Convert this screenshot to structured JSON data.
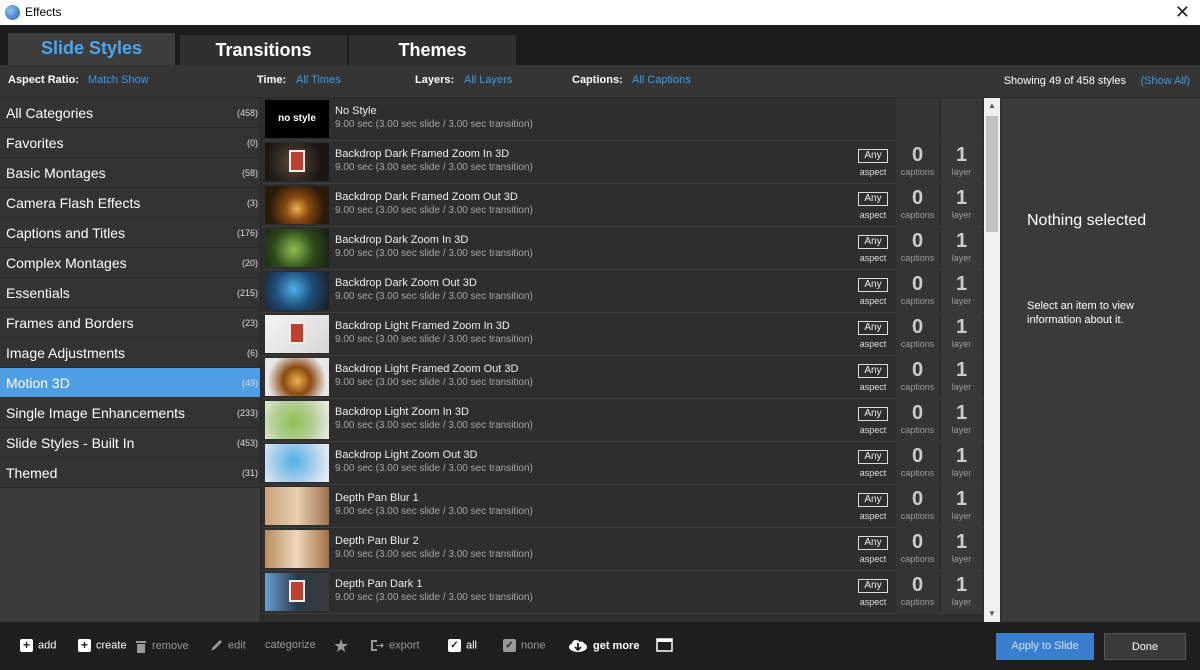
{
  "window": {
    "title": "Effects",
    "close_glyph": "✕"
  },
  "tabs": [
    {
      "label": "Slide Styles",
      "active": true
    },
    {
      "label": "Transitions",
      "active": false
    },
    {
      "label": "Themes",
      "active": false
    }
  ],
  "filters": {
    "aspect_label": "Aspect Ratio:",
    "aspect_value": "Match Show",
    "time_label": "Time:",
    "time_value": "All Times",
    "layers_label": "Layers:",
    "layers_value": "All Layers",
    "captions_label": "Captions:",
    "captions_value": "All Captions",
    "showing": "Showing 49 of 458 styles",
    "show_all": "(Show All)"
  },
  "categories": [
    {
      "name": "All Categories",
      "count": "(458)"
    },
    {
      "name": "Favorites",
      "count": "(0)"
    },
    {
      "name": "Basic Montages",
      "count": "(58)"
    },
    {
      "name": "Camera Flash Effects",
      "count": "(3)"
    },
    {
      "name": "Captions and Titles",
      "count": "(176)"
    },
    {
      "name": "Complex Montages",
      "count": "(20)"
    },
    {
      "name": "Essentials",
      "count": "(215)"
    },
    {
      "name": "Frames and Borders",
      "count": "(23)"
    },
    {
      "name": "Image Adjustments",
      "count": "(6)"
    },
    {
      "name": "Motion 3D",
      "count": "(49)",
      "selected": true
    },
    {
      "name": "Single Image Enhancements",
      "count": "(233)"
    },
    {
      "name": "Slide Styles - Built In",
      "count": "(453)"
    },
    {
      "name": "Themed",
      "count": "(31)"
    }
  ],
  "styles": [
    {
      "name": "No Style",
      "duration": "9.00 sec (3.00 sec slide / 3.00 sec transition)",
      "thumb": "nostyle",
      "thumb_text": "no style",
      "stats": false
    },
    {
      "name": "Backdrop Dark Framed Zoom In 3D",
      "duration": "9.00 sec (3.00 sec slide / 3.00 sec transition)",
      "thumb": "dark",
      "aspect": "Any",
      "aspect_label": "aspect",
      "captions": "0",
      "captions_label": "captions",
      "layers": "1",
      "layers_label": "layer",
      "stats": true
    },
    {
      "name": "Backdrop Dark Framed Zoom Out 3D",
      "duration": "9.00 sec (3.00 sec slide / 3.00 sec transition)",
      "thumb": "forest",
      "aspect": "Any",
      "aspect_label": "aspect",
      "captions": "0",
      "captions_label": "captions",
      "layers": "1",
      "layers_label": "layer",
      "stats": true
    },
    {
      "name": "Backdrop Dark Zoom In 3D",
      "duration": "9.00 sec (3.00 sec slide / 3.00 sec transition)",
      "thumb": "green",
      "aspect": "Any",
      "aspect_label": "aspect",
      "captions": "0",
      "captions_label": "captions",
      "layers": "1",
      "layers_label": "layer",
      "stats": true
    },
    {
      "name": "Backdrop Dark Zoom Out 3D",
      "duration": "9.00 sec (3.00 sec slide / 3.00 sec transition)",
      "thumb": "blue",
      "aspect": "Any",
      "aspect_label": "aspect",
      "captions": "0",
      "captions_label": "captions",
      "layers": "1",
      "layers_label": "layer",
      "stats": true
    },
    {
      "name": "Backdrop Light Framed Zoom In 3D",
      "duration": "9.00 sec (3.00 sec slide / 3.00 sec transition)",
      "thumb": "light",
      "aspect": "Any",
      "aspect_label": "aspect",
      "captions": "0",
      "captions_label": "captions",
      "layers": "1",
      "layers_label": "layer",
      "stats": true
    },
    {
      "name": "Backdrop Light Framed Zoom Out 3D",
      "duration": "9.00 sec (3.00 sec slide / 3.00 sec transition)",
      "thumb": "forestl",
      "aspect": "Any",
      "aspect_label": "aspect",
      "captions": "0",
      "captions_label": "captions",
      "layers": "1",
      "layers_label": "layer",
      "stats": true
    },
    {
      "name": "Backdrop Light Zoom In 3D",
      "duration": "9.00 sec (3.00 sec slide / 3.00 sec transition)",
      "thumb": "greenl",
      "aspect": "Any",
      "aspect_label": "aspect",
      "captions": "0",
      "captions_label": "captions",
      "layers": "1",
      "layers_label": "layer",
      "stats": true
    },
    {
      "name": "Backdrop Light Zoom Out 3D",
      "duration": "9.00 sec (3.00 sec slide / 3.00 sec transition)",
      "thumb": "bluel",
      "aspect": "Any",
      "aspect_label": "aspect",
      "captions": "0",
      "captions_label": "captions",
      "layers": "1",
      "layers_label": "layer",
      "stats": true
    },
    {
      "name": "Depth Pan Blur 1",
      "duration": "9.00 sec (3.00 sec slide / 3.00 sec transition)",
      "thumb": "blur1",
      "aspect": "Any",
      "aspect_label": "aspect",
      "captions": "0",
      "captions_label": "captions",
      "layers": "1",
      "layers_label": "layer",
      "stats": true
    },
    {
      "name": "Depth Pan Blur 2",
      "duration": "9.00 sec (3.00 sec slide / 3.00 sec transition)",
      "thumb": "blur2",
      "aspect": "Any",
      "aspect_label": "aspect",
      "captions": "0",
      "captions_label": "captions",
      "layers": "1",
      "layers_label": "layer",
      "stats": true
    },
    {
      "name": "Depth Pan Dark 1",
      "duration": "9.00 sec (3.00 sec slide / 3.00 sec transition)",
      "thumb": "dark1",
      "aspect": "Any",
      "aspect_label": "aspect",
      "captions": "0",
      "captions_label": "captions",
      "layers": "1",
      "layers_label": "layer",
      "stats": true
    }
  ],
  "scrollbar": {
    "up_glyph": "▲",
    "down_glyph": "▼"
  },
  "info": {
    "title": "Nothing selected",
    "description": "Select an item to view information about it."
  },
  "toolbar": {
    "add": "add",
    "create": "create",
    "remove": "remove",
    "edit": "edit",
    "categorize": "categorize",
    "export": "export",
    "all": "all",
    "none": "none",
    "get_more": "get more",
    "apply": "Apply to Slide",
    "done": "Done"
  },
  "colors": {
    "accent": "#4aa6ee",
    "selected_category": "#4f9ee3",
    "apply_button": "#3a7fcf"
  }
}
